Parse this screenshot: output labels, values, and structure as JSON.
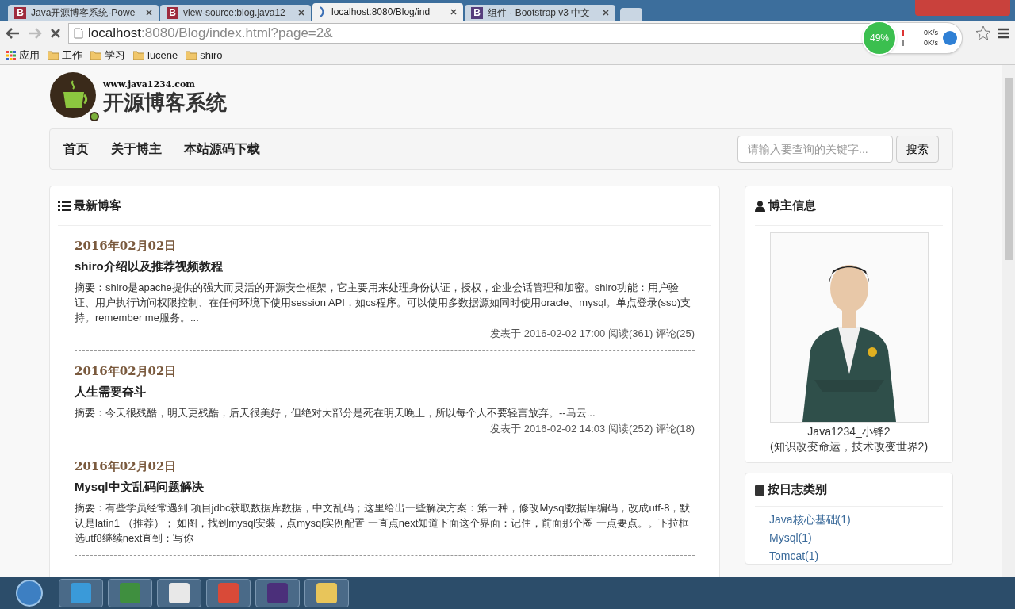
{
  "browser": {
    "tabs": [
      {
        "title": "Java开源博客系统-Powe",
        "favicon": "B",
        "selected": false
      },
      {
        "title": "view-source:blog.java12",
        "favicon": "B",
        "selected": false
      },
      {
        "title": "localhost:8080/Blog/ind",
        "loading": true,
        "selected": true
      },
      {
        "title": "组件 · Bootstrap v3 中文",
        "favicon": "B",
        "selected": false
      }
    ],
    "address": {
      "host": "localhost",
      "rest": ":8080/Blog/index.html?page=2&"
    },
    "bookmarks": [
      {
        "label": "应用",
        "kind": "apps"
      },
      {
        "label": "工作",
        "kind": "folder"
      },
      {
        "label": "学习",
        "kind": "folder"
      },
      {
        "label": "lucene",
        "kind": "folder"
      },
      {
        "label": "shiro",
        "kind": "folder"
      }
    ],
    "speed": {
      "percent": "49%",
      "up": "0K/s",
      "down": "0K/s"
    }
  },
  "site": {
    "url": "www.java1234.com",
    "title": "开源博客系统"
  },
  "nav": {
    "items": [
      "首页",
      "关于博主",
      "本站源码下载"
    ],
    "search": {
      "placeholder": "请输入要查询的关键字...",
      "button": "搜索"
    }
  },
  "blogs": {
    "title": "最新博客",
    "posts": [
      {
        "date": "2016年02月02日",
        "title": "shiro介绍以及推荐视频教程",
        "summary": "摘要：shiro是apache提供的强大而灵活的开源安全框架，它主要用来处理身份认证，授权，企业会话管理和加密。shiro功能：用户验证、用户执行访问权限控制、在任何环境下使用session API，如cs程序。可以使用多数据源如同时使用oracle、mysql。单点登录(sso)支持。remember me服务。...",
        "meta": "发表于 2016-02-02 17:00 阅读(361) 评论(25)"
      },
      {
        "date": "2016年02月02日",
        "title": "人生需要奋斗",
        "summary": "摘要：今天很残酷，明天更残酷，后天很美好，但绝对大部分是死在明天晚上，所以每个人不要轻言放弃。--马云...",
        "meta": "发表于 2016-02-02 14:03 阅读(252) 评论(18)"
      },
      {
        "date": "2016年02月02日",
        "title": "Mysql中文乱码问题解决",
        "summary": "摘要：有些学员经常遇到 项目jdbc获取数据库数据，中文乱码；这里给出一些解决方案：第一种，修改Mysql数据库编码，改成utf-8，默认是latin1 （推荐）； 如图，找到mysql安装，点mysql实例配置 一直点next知道下面这个界面：记住，前面那个圈 一点要点。。下拉框选utf8继续next直到：写你"
      }
    ]
  },
  "blogger": {
    "title": "博主信息",
    "name": "Java1234_小锋2",
    "motto": "(知识改变命运，技术改变世界2)"
  },
  "categories": {
    "title": "按日志类别",
    "items": [
      "Java核心基础(1)",
      "Mysql(1)",
      "Tomcat(1)"
    ]
  }
}
